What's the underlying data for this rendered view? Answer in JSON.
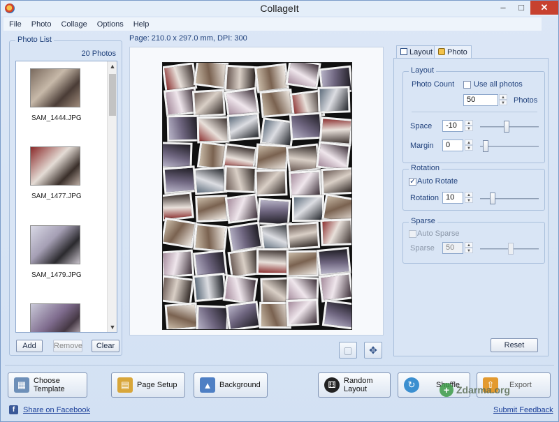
{
  "window": {
    "title": "CollageIt"
  },
  "menu": [
    "File",
    "Photo",
    "Collage",
    "Options",
    "Help"
  ],
  "photo_list": {
    "title": "Photo List",
    "count": "20 Photos",
    "items": [
      {
        "name": "SAM_1444.JPG"
      },
      {
        "name": "SAM_1477.JPG"
      },
      {
        "name": "SAM_1479.JPG"
      },
      {
        "name": ""
      }
    ],
    "add": "Add",
    "remove": "Remove",
    "clear": "Clear"
  },
  "page_info": "Page: 210.0 x 297.0 mm, DPI: 300",
  "tabs": {
    "layout": "Layout",
    "photo": "Photo"
  },
  "layout": {
    "title": "Layout",
    "photo_count_label": "Photo Count",
    "use_all_label": "Use all photos",
    "photo_count_value": "50",
    "photos_unit": "Photos",
    "space_label": "Space",
    "space_value": "-10",
    "margin_label": "Margin",
    "margin_value": "0"
  },
  "rotation": {
    "title": "Rotation",
    "auto_label": "Auto Rotate",
    "rotation_label": "Rotation",
    "rotation_value": "10"
  },
  "sparse": {
    "title": "Sparse",
    "auto_label": "Auto Sparse",
    "sparse_label": "Sparse",
    "sparse_value": "50"
  },
  "reset": "Reset",
  "toolbar": {
    "choose_template": "Choose Template",
    "page_setup": "Page Setup",
    "background": "Background",
    "random_layout": "Random Layout",
    "shuffle": "Shuffle",
    "export": "Export"
  },
  "footer": {
    "share": "Share on Facebook",
    "feedback": "Submit Feedback"
  },
  "watermark": "Zdarma.org"
}
